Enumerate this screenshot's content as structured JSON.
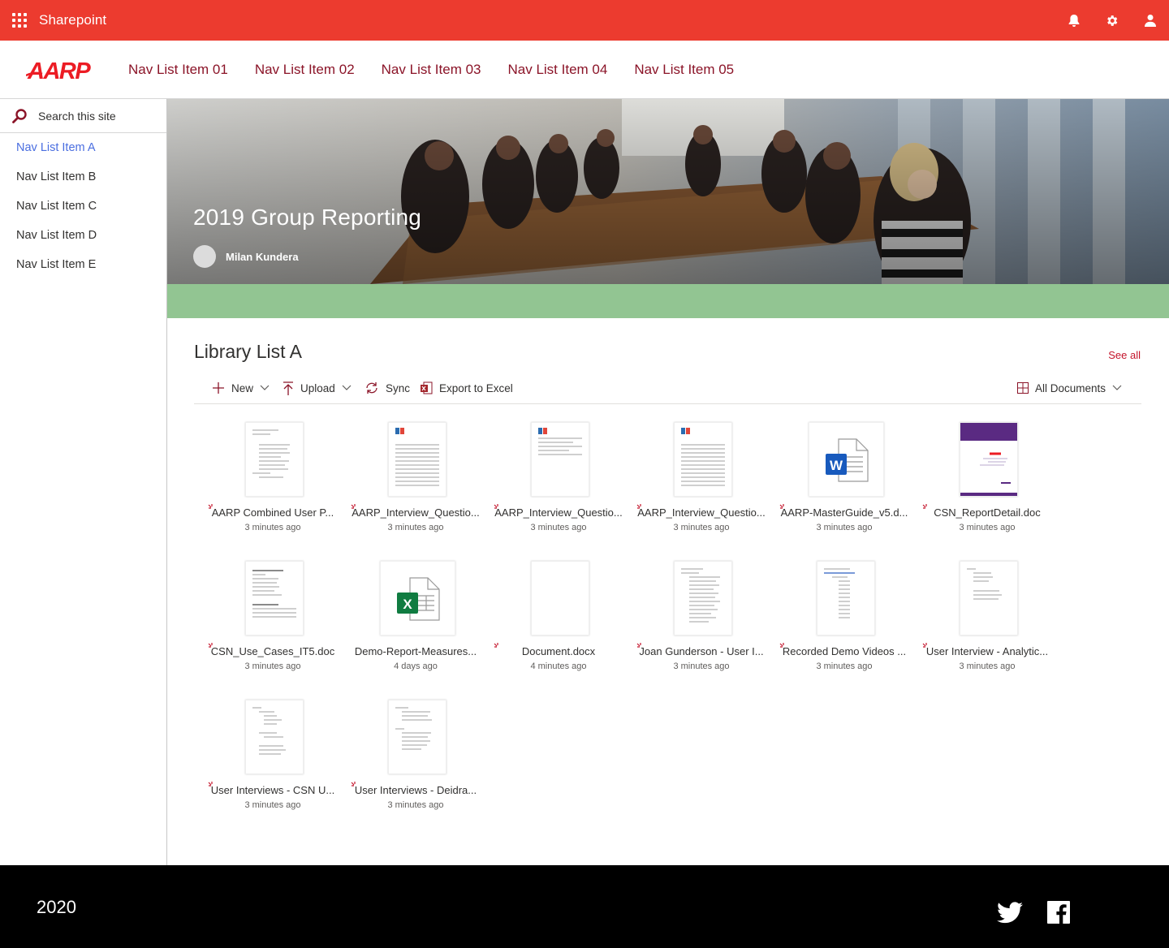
{
  "suite": {
    "title": "Sharepoint"
  },
  "brand": {
    "logo_text": "AARP"
  },
  "top_nav": [
    "Nav List Item 01",
    "Nav List Item 02",
    "Nav List Item 03",
    "Nav List Item 04",
    "Nav List Item 05"
  ],
  "left_nav": {
    "search_placeholder": "Search this site",
    "items": [
      "Nav List Item A",
      "Nav List Item B",
      "Nav List Item C",
      "Nav List Item D",
      "Nav List Item E"
    ],
    "active_index": 0
  },
  "hero": {
    "title": "2019 Group Reporting",
    "author": "Milan Kundera"
  },
  "library": {
    "title": "Library List A",
    "see_all": "See all",
    "commands": {
      "new": "New",
      "upload": "Upload",
      "sync": "Sync",
      "export": "Export to Excel",
      "view": "All Documents"
    },
    "files": [
      {
        "name": "AARP Combined User P...",
        "meta": "3 minutes ago",
        "thumb": "doc"
      },
      {
        "name": "AARP_Interview_Questio...",
        "meta": "3 minutes ago",
        "thumb": "form"
      },
      {
        "name": "AARP_Interview_Questio...",
        "meta": "3 minutes ago",
        "thumb": "form-landscape"
      },
      {
        "name": "AARP_Interview_Questio...",
        "meta": "3 minutes ago",
        "thumb": "form"
      },
      {
        "name": "AARP-MasterGuide_v5.d...",
        "meta": "3 minutes ago",
        "thumb": "word-icon"
      },
      {
        "name": "CSN_ReportDetail.doc",
        "meta": "3 minutes ago",
        "thumb": "report-cover"
      },
      {
        "name": "CSN_Use_Cases_IT5.doc",
        "meta": "3 minutes ago",
        "thumb": "doc-table"
      },
      {
        "name": "Demo-Report-Measures...",
        "meta": "4 days ago",
        "thumb": "excel-icon"
      },
      {
        "name": "Document.docx",
        "meta": "4 minutes ago",
        "thumb": "blank"
      },
      {
        "name": "Joan Gunderson - User I...",
        "meta": "3 minutes ago",
        "thumb": "doc"
      },
      {
        "name": "Recorded Demo Videos ...",
        "meta": "3 minutes ago",
        "thumb": "doc-links"
      },
      {
        "name": "User Interview - Analytic...",
        "meta": "3 minutes ago",
        "thumb": "doc-sparse"
      },
      {
        "name": "User Interviews - CSN U...",
        "meta": "3 minutes ago",
        "thumb": "doc-sparse"
      },
      {
        "name": "User Interviews - Deidra...",
        "meta": "3 minutes ago",
        "thumb": "doc"
      }
    ]
  },
  "footer": {
    "year": "2020",
    "social": [
      "twitter-icon",
      "facebook-icon"
    ]
  },
  "colors": {
    "suite_bar": "#ec3b2f",
    "brand": "#8b1428",
    "accent_link": "#4a6ee0",
    "band": "#92c592",
    "see_all": "#c4142b"
  }
}
